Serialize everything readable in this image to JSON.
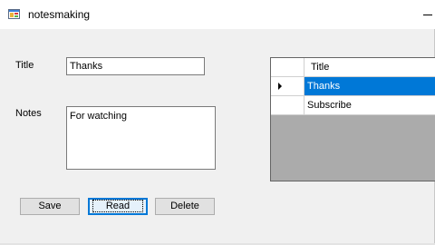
{
  "window": {
    "title": "notesmaking"
  },
  "form": {
    "title_label": "Title",
    "title_value": "Thanks",
    "notes_label": "Notes",
    "notes_value": "For watching"
  },
  "buttons": {
    "save": "Save",
    "read": "Read",
    "delete": "Delete"
  },
  "grid": {
    "column_header": "Title",
    "rows": [
      {
        "title": "Thanks",
        "selected": true
      },
      {
        "title": "Subscribe",
        "selected": false
      }
    ]
  },
  "colors": {
    "selection": "#0078d7",
    "grid_background": "#ababab",
    "window_background": "#f0f0f0",
    "focus_border": "#0078d7"
  },
  "icons": {
    "app": "form-window-icon",
    "minimize": "minimize-icon",
    "row_indicator": "current-row-arrow-icon"
  }
}
